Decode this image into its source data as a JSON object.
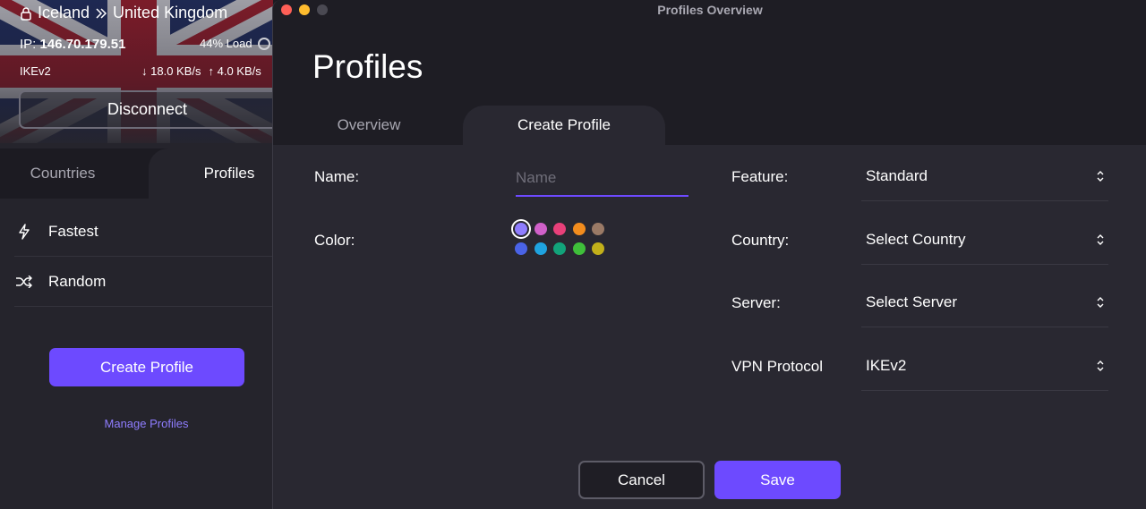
{
  "main": {
    "connection": {
      "from_country": "Iceland",
      "to_country": "United Kingdom",
      "ip_label": "IP:",
      "ip": "146.70.179.51",
      "load": "44% Load",
      "protocol": "IKEv2",
      "download": "18.0 KB/s",
      "upload": "4.0 KB/s"
    },
    "disconnect_label": "Disconnect",
    "tabs": [
      {
        "label": "Countries",
        "active": false
      },
      {
        "label": "Profiles",
        "active": true
      }
    ],
    "profiles": [
      {
        "label": "Fastest",
        "icon": "lightning-icon"
      },
      {
        "label": "Random",
        "icon": "shuffle-icon"
      }
    ],
    "create_profile_label": "Create Profile",
    "manage_profiles_label": "Manage Profiles"
  },
  "dialog": {
    "window_title": "Profiles Overview",
    "title": "Profiles",
    "tabs": [
      {
        "label": "Overview",
        "active": false
      },
      {
        "label": "Create Profile",
        "active": true
      }
    ],
    "form": {
      "name_label": "Name:",
      "name_value": "",
      "name_placeholder": "Name",
      "color_label": "Color:",
      "colors": [
        "#8f7dff",
        "#d060c9",
        "#e8407a",
        "#f28c1d",
        "#9a7a66",
        "#4a63e6",
        "#1fa3e0",
        "#12a37a",
        "#3fbf3a",
        "#c2b01a"
      ],
      "selected_color": "#8f7dff",
      "feature_label": "Feature:",
      "feature_value": "Standard",
      "country_label": "Country:",
      "country_value": "Select Country",
      "server_label": "Server:",
      "server_value": "Select Server",
      "protocol_label": "VPN Protocol",
      "protocol_value": "IKEv2"
    },
    "cancel_label": "Cancel",
    "save_label": "Save"
  },
  "colors": {
    "accent": "#6d4aff",
    "link": "#8f7dff",
    "background": "#1c1b22",
    "panel": "#292831"
  }
}
